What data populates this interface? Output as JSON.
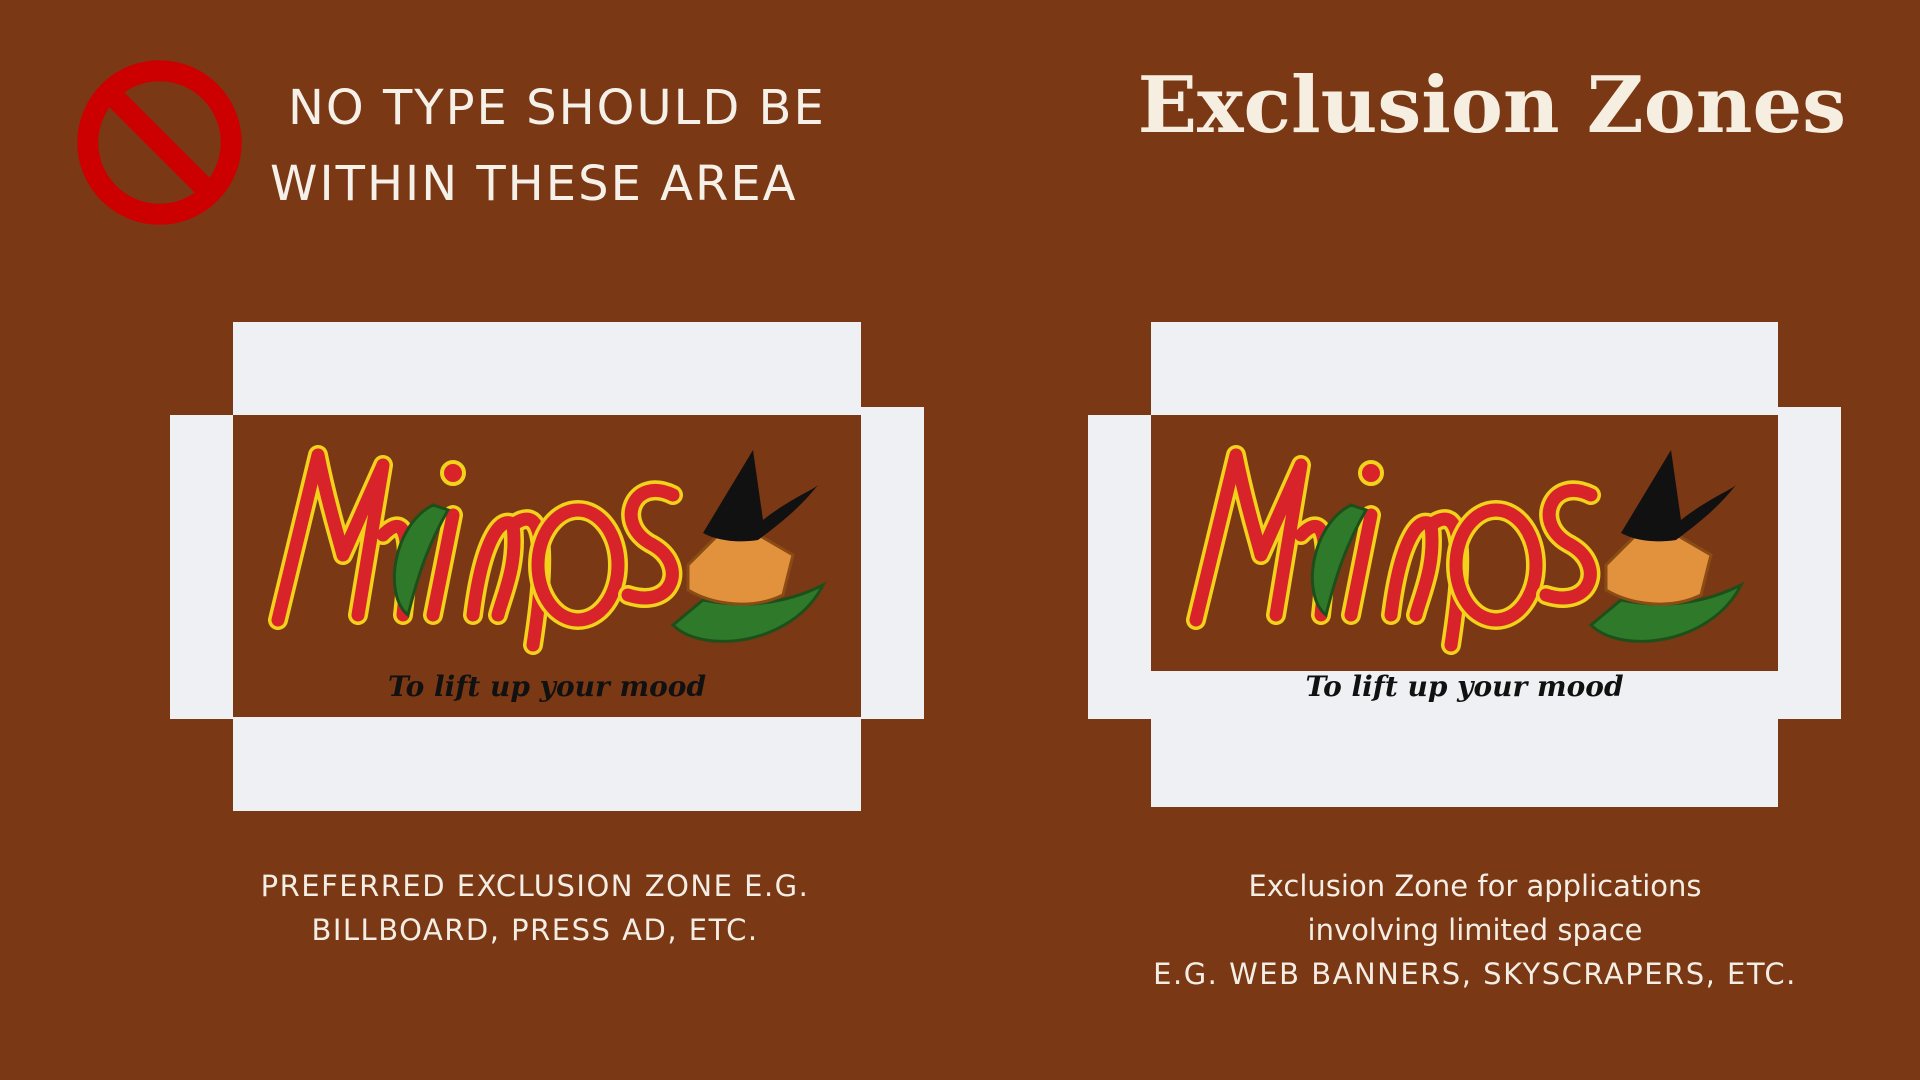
{
  "header": {
    "warning_line1": "NO TYPE SHOULD BE",
    "warning_line2": "WITHIN THESE AREA",
    "title": "Exclusion Zones",
    "no_icon": "no-entry-icon"
  },
  "logo": {
    "wordmark": "Mimos",
    "tagline": "To lift up your mood"
  },
  "left_zone": {
    "caption_line1": "PREFERRED EXCLUSION ZONE E.G.",
    "caption_line2": "BILLBOARD, PRESS AD, ETC."
  },
  "right_zone": {
    "caption_line1": "Exclusion Zone for applications",
    "caption_line2": "involving limited space",
    "caption_line3": "E.G. WEB BANNERS, SKYSCRAPERS, ETC."
  },
  "colors": {
    "background": "#7a3814",
    "zone_fill": "#eef0f3",
    "logo_red": "#d8232a",
    "logo_yellow": "#f2d21a",
    "chili_green": "#2f7a2a",
    "no_sign_red": "#cc0000"
  }
}
